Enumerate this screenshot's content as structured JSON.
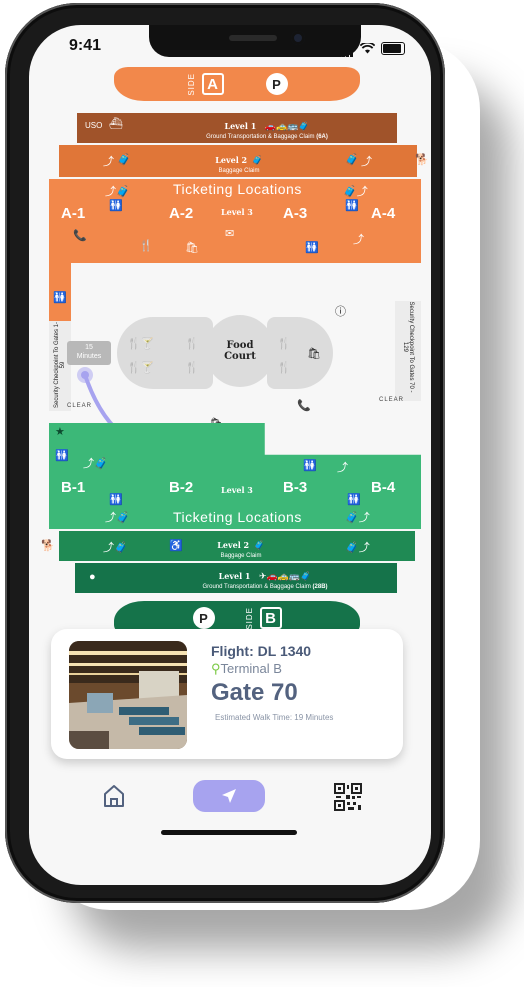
{
  "status": {
    "time": "9:41"
  },
  "side_a": {
    "side_word": "SIDE",
    "letter": "A",
    "parking": "P"
  },
  "side_b": {
    "side_word": "SIDE",
    "letter": "B",
    "parking": "P"
  },
  "concourse_a": {
    "level1": {
      "code": "USO",
      "title": "Level 1",
      "subtitle": "Ground Transportation & Baggage Claim",
      "note": "(6A)"
    },
    "level2": {
      "title": "Level 2",
      "subtitle": "Baggage Claim"
    },
    "ticketing": "Ticketing Locations",
    "level3": "Level 3",
    "gates": [
      "A-1",
      "A-2",
      "A-3",
      "A-4"
    ]
  },
  "concourse_b": {
    "level1": {
      "title": "Level 1",
      "subtitle": "Ground Transportation & Baggage Claim",
      "note": "(28B)"
    },
    "level2": {
      "title": "Level 2",
      "subtitle": "Baggage Claim"
    },
    "ticketing": "Ticketing Locations",
    "level3": "Level 3",
    "gates": [
      "B-1",
      "B-2",
      "B-3",
      "B-4"
    ]
  },
  "map": {
    "food_court": "Food\nCourt",
    "food_court_l1": "Food",
    "food_court_l2": "Court",
    "security_left": "Security Checkpoint To Gates 1-59",
    "security_right": "Security Checkpoint To Gates 70 - 129",
    "clear_label": "CLEAR",
    "route_minutes_value": "15",
    "route_minutes_unit": "Minutes"
  },
  "flight_card": {
    "flight": "Flight: DL 1340",
    "terminal": "Terminal B",
    "gate": "Gate 70",
    "walk_time": "Estimated Walk Time: 19 Minutes"
  },
  "colors": {
    "orange": "#f2884b",
    "orange_dark": "#e07638",
    "brown": "#a0532a",
    "green": "#3cb878",
    "green_dark": "#1f8a54",
    "green_darker": "#15734a",
    "route": "#a7a3ef"
  },
  "icons": [
    "home-icon",
    "navigate-arrow-icon",
    "qr-code-icon",
    "restroom-icon",
    "escalator-icon",
    "baggage-icon",
    "dining-icon",
    "shopping-icon",
    "elevator-icon",
    "phone-icon",
    "info-icon",
    "pet-icon"
  ]
}
